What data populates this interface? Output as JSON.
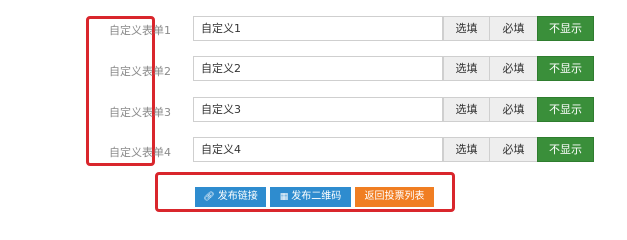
{
  "rows": [
    {
      "label": "自定义表单1",
      "value": "自定义1",
      "fill": "选填",
      "required": "必填",
      "hide": "不显示"
    },
    {
      "label": "自定义表单2",
      "value": "自定义2",
      "fill": "选填",
      "required": "必填",
      "hide": "不显示"
    },
    {
      "label": "自定义表单3",
      "value": "自定义3",
      "fill": "选填",
      "required": "必填",
      "hide": "不显示"
    },
    {
      "label": "自定义表单4",
      "value": "自定义4",
      "fill": "选填",
      "required": "必填",
      "hide": "不显示"
    }
  ],
  "actions": {
    "publish_link": "发布链接",
    "publish_qr": "发布二维码",
    "back_to_list": "返回投票列表"
  },
  "icons": {
    "link": "link-icon",
    "qr": "qrcode-icon"
  },
  "colors": {
    "hidden_active": "#3a8f3a",
    "primary": "#2e8ccf",
    "warning": "#f07e22",
    "highlight": "#d9262c"
  }
}
